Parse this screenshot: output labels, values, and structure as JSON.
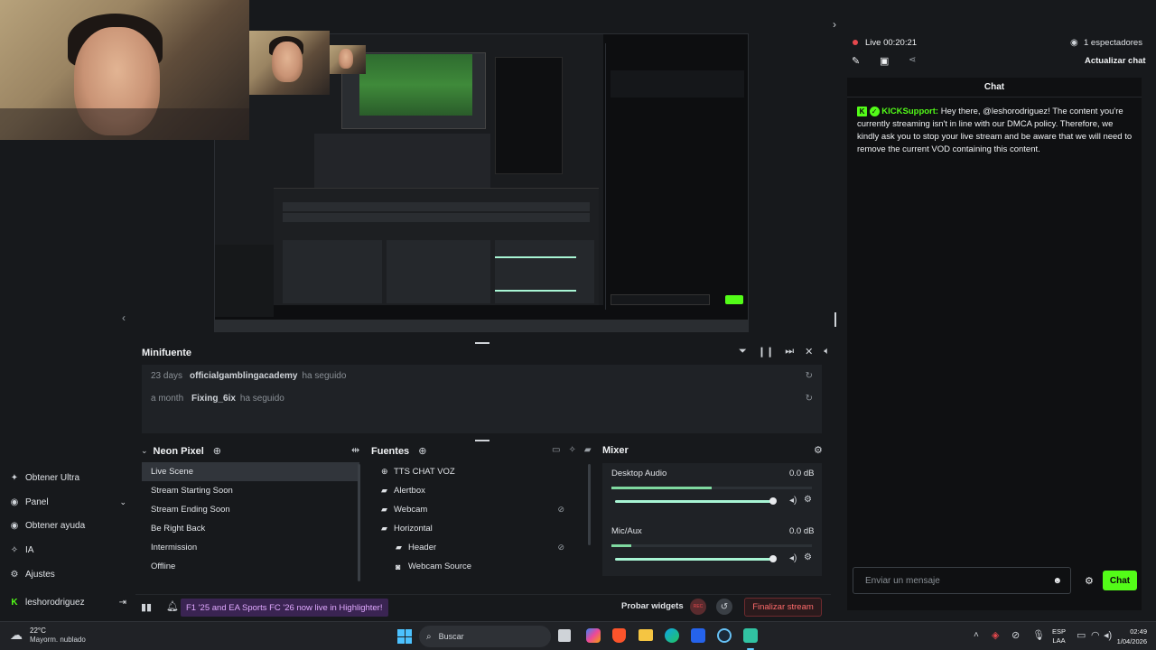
{
  "sidebar": {
    "items": [
      {
        "label": "Obtener Ultra",
        "icon": "ultra-icon"
      },
      {
        "label": "Panel",
        "icon": "dashboard-icon"
      },
      {
        "label": "Obtener ayuda",
        "icon": "help-icon"
      },
      {
        "label": "IA",
        "icon": "sparkle-icon"
      },
      {
        "label": "Ajustes",
        "icon": "gear-icon"
      }
    ],
    "user": "leshorodriguez"
  },
  "minifuente": {
    "title": "Minifuente",
    "rows": [
      {
        "time": "23 days",
        "name": "officialgamblingacademy",
        "action": "ha seguido"
      },
      {
        "time": "a month",
        "name": "Fixing_6ix",
        "action": "ha seguido"
      }
    ]
  },
  "scenes": {
    "title": "Neon Pixel",
    "items": [
      "Live Scene",
      "Stream Starting Soon",
      "Stream Ending Soon",
      "Be Right Back",
      "Intermission",
      "Offline"
    ],
    "selected": 0
  },
  "sources": {
    "title": "Fuentes",
    "items": [
      {
        "label": "TTS CHAT VOZ",
        "icon": "globe-icon",
        "indent": 0,
        "hidden": false
      },
      {
        "label": "Alertbox",
        "icon": "folder-icon",
        "indent": 0,
        "hidden": false
      },
      {
        "label": "Webcam",
        "icon": "folder-icon",
        "indent": 0,
        "hidden": true
      },
      {
        "label": "Horizontal",
        "icon": "folder-icon",
        "indent": 0,
        "hidden": false
      },
      {
        "label": "Header",
        "icon": "folder-icon",
        "indent": 1,
        "hidden": true
      },
      {
        "label": "Webcam Source",
        "icon": "camera-icon",
        "indent": 1,
        "hidden": false
      }
    ]
  },
  "mixer": {
    "title": "Mixer",
    "channels": [
      {
        "name": "Desktop Audio",
        "db": "0.0 dB",
        "volume": 1.0,
        "meter": 0.5
      },
      {
        "name": "Mic/Aux",
        "db": "0.0 dB",
        "volume": 1.0,
        "meter": 0.1
      }
    ]
  },
  "bottombar": {
    "ticker": "F1 '25 and EA Sports FC '26 now live in Highlighter!",
    "test_widgets": "Probar widgets",
    "rec": "REC",
    "end_stream": "Finalizar stream"
  },
  "stream": {
    "status": "Live 00:20:21",
    "viewers": "1 espectadores",
    "refresh_chat": "Actualizar chat"
  },
  "chat": {
    "title": "Chat",
    "messages": [
      {
        "user": "KICKSupport:",
        "text": "Hey there, @leshorodriguez! The content you're currently streaming isn't in line with our DMCA policy. Therefore, we kindly ask you to stop your live stream and be aware that we will need to remove the current VOD containing this content."
      }
    ],
    "input_placeholder": "Enviar un mensaje",
    "send_label": "Chat"
  },
  "taskbar": {
    "weather_temp": "22°C",
    "weather_desc": "Mayorm. nublado",
    "search_placeholder": "Buscar",
    "lang": "ESP",
    "lang2": "LAA",
    "time": "02:49",
    "date": "1/04/2026"
  },
  "colors": {
    "kick_green": "#53fc18",
    "live_red": "#e5484d",
    "accent_mint": "#a8f5d4"
  }
}
